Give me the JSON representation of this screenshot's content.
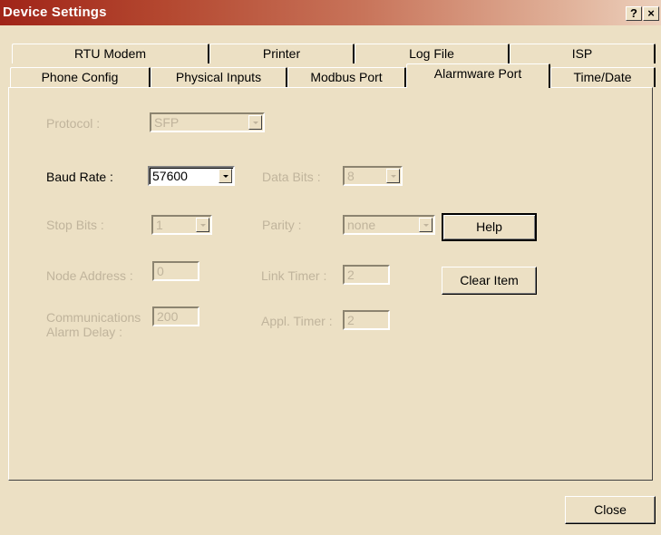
{
  "window": {
    "title": "Device Settings",
    "help_glyph": "?",
    "close_glyph": "×"
  },
  "tabs_row1": [
    "RTU Modem",
    "Printer",
    "Log File",
    "ISP"
  ],
  "tabs_row2": [
    "Phone Config",
    "Physical Inputs",
    "Modbus Port",
    "Alarmware Port",
    "Time/Date"
  ],
  "active_tab": "Alarmware Port",
  "form": {
    "protocol": {
      "label": "Protocol :",
      "value": "SFP",
      "enabled": false
    },
    "baud_rate": {
      "label": "Baud Rate :",
      "value": "57600",
      "enabled": true
    },
    "data_bits": {
      "label": "Data Bits :",
      "value": "8",
      "enabled": false
    },
    "stop_bits": {
      "label": "Stop Bits :",
      "value": "1",
      "enabled": false
    },
    "parity": {
      "label": "Parity :",
      "value": "none",
      "enabled": false
    },
    "node_address": {
      "label": "Node Address :",
      "value": "0",
      "enabled": false
    },
    "link_timer": {
      "label": "Link Timer :",
      "value": "2",
      "enabled": false
    },
    "comm_alarm_delay": {
      "label_line1": "Communications",
      "label_line2": "Alarm Delay :",
      "value": "200",
      "enabled": false
    },
    "appl_timer": {
      "label": "Appl. Timer :",
      "value": "2",
      "enabled": false
    }
  },
  "buttons": {
    "help": "Help",
    "clear_item": "Clear Item",
    "close": "Close"
  }
}
